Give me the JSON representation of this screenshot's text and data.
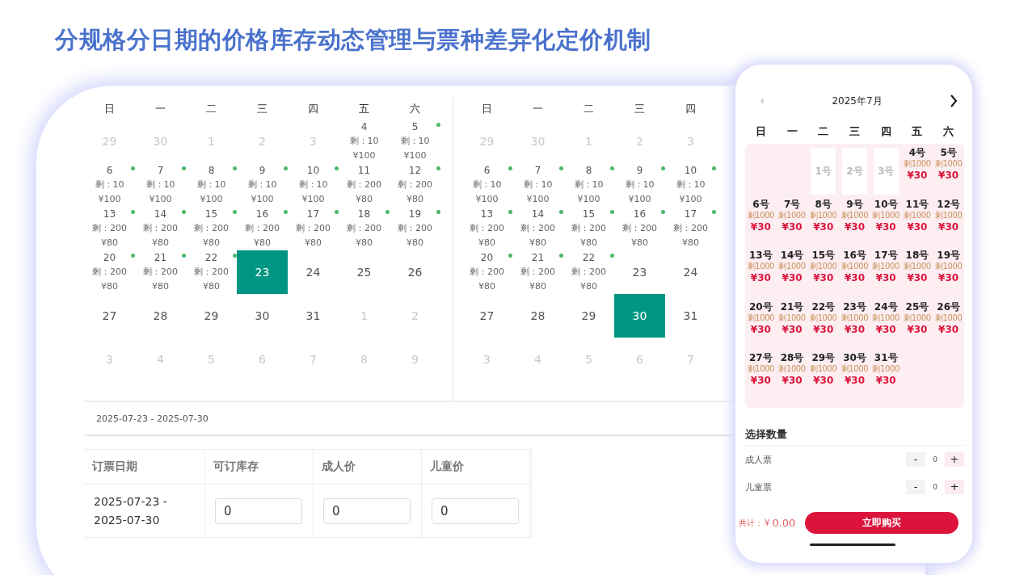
{
  "title": "分规格分日期的价格库存动态管理与票种差异化定价机制",
  "admin": {
    "calendars": [
      {
        "weekdays": [
          "日",
          "一",
          "二",
          "三",
          "四",
          "五",
          "六"
        ],
        "weeks": [
          [
            {
              "day": "29",
              "muted": true,
              "selected": false,
              "dot": false
            },
            {
              "day": "30",
              "muted": true,
              "selected": false,
              "dot": false
            },
            {
              "day": "1",
              "muted": true,
              "selected": false,
              "dot": false
            },
            {
              "day": "2",
              "muted": true,
              "selected": false,
              "dot": false
            },
            {
              "day": "3",
              "muted": true,
              "selected": false,
              "dot": false
            },
            {
              "day": "4",
              "muted": false,
              "selected": false,
              "dot": false,
              "stock": "剩：10",
              "price": "¥100"
            },
            {
              "day": "5",
              "muted": false,
              "selected": false,
              "dot": true,
              "stock": "剩：10",
              "price": "¥100"
            }
          ],
          [
            {
              "day": "6",
              "muted": false,
              "selected": false,
              "dot": true,
              "stock": "剩：10",
              "price": "¥100"
            },
            {
              "day": "7",
              "muted": false,
              "selected": false,
              "dot": true,
              "stock": "剩：10",
              "price": "¥100"
            },
            {
              "day": "8",
              "muted": false,
              "selected": false,
              "dot": true,
              "stock": "剩：10",
              "price": "¥100"
            },
            {
              "day": "9",
              "muted": false,
              "selected": false,
              "dot": true,
              "stock": "剩：10",
              "price": "¥100"
            },
            {
              "day": "10",
              "muted": false,
              "selected": false,
              "dot": true,
              "stock": "剩：10",
              "price": "¥100"
            },
            {
              "day": "11",
              "muted": false,
              "selected": false,
              "dot": false,
              "stock": "剩：200",
              "price": "¥80"
            },
            {
              "day": "12",
              "muted": false,
              "selected": false,
              "dot": true,
              "stock": "剩：200",
              "price": "¥80"
            }
          ],
          [
            {
              "day": "13",
              "muted": false,
              "selected": false,
              "dot": true,
              "stock": "剩：200",
              "price": "¥80"
            },
            {
              "day": "14",
              "muted": false,
              "selected": false,
              "dot": true,
              "stock": "剩：200",
              "price": "¥80"
            },
            {
              "day": "15",
              "muted": false,
              "selected": false,
              "dot": true,
              "stock": "剩：200",
              "price": "¥80"
            },
            {
              "day": "16",
              "muted": false,
              "selected": false,
              "dot": true,
              "stock": "剩：200",
              "price": "¥80"
            },
            {
              "day": "17",
              "muted": false,
              "selected": false,
              "dot": true,
              "stock": "剩：200",
              "price": "¥80"
            },
            {
              "day": "18",
              "muted": false,
              "selected": false,
              "dot": true,
              "stock": "剩：200",
              "price": "¥80"
            },
            {
              "day": "19",
              "muted": false,
              "selected": false,
              "dot": true,
              "stock": "剩：200",
              "price": "¥80"
            }
          ],
          [
            {
              "day": "20",
              "muted": false,
              "selected": false,
              "dot": true,
              "stock": "剩：200",
              "price": "¥80"
            },
            {
              "day": "21",
              "muted": false,
              "selected": false,
              "dot": true,
              "stock": "剩：200",
              "price": "¥80"
            },
            {
              "day": "22",
              "muted": false,
              "selected": false,
              "dot": true,
              "stock": "剩：200",
              "price": "¥80"
            },
            {
              "day": "23",
              "muted": false,
              "selected": true,
              "dot": false
            },
            {
              "day": "24",
              "muted": false,
              "selected": false,
              "dot": false
            },
            {
              "day": "25",
              "muted": false,
              "selected": false,
              "dot": false
            },
            {
              "day": "26",
              "muted": false,
              "selected": false,
              "dot": false
            }
          ],
          [
            {
              "day": "27",
              "muted": false,
              "selected": false,
              "dot": false
            },
            {
              "day": "28",
              "muted": false,
              "selected": false,
              "dot": false
            },
            {
              "day": "29",
              "muted": false,
              "selected": false,
              "dot": false
            },
            {
              "day": "30",
              "muted": false,
              "selected": false,
              "dot": false
            },
            {
              "day": "31",
              "muted": false,
              "selected": false,
              "dot": false
            },
            {
              "day": "1",
              "muted": true,
              "selected": false,
              "dot": false
            },
            {
              "day": "2",
              "muted": true,
              "selected": false,
              "dot": false
            }
          ],
          [
            {
              "day": "3",
              "muted": true,
              "selected": false,
              "dot": false
            },
            {
              "day": "4",
              "muted": true,
              "selected": false,
              "dot": false
            },
            {
              "day": "5",
              "muted": true,
              "selected": false,
              "dot": false
            },
            {
              "day": "6",
              "muted": true,
              "selected": false,
              "dot": false
            },
            {
              "day": "7",
              "muted": true,
              "selected": false,
              "dot": false
            },
            {
              "day": "8",
              "muted": true,
              "selected": false,
              "dot": false
            },
            {
              "day": "9",
              "muted": true,
              "selected": false,
              "dot": false
            }
          ]
        ]
      },
      {
        "weekdays": [
          "日",
          "一",
          "二",
          "三",
          "四"
        ],
        "weeks": [
          [
            {
              "day": "29",
              "muted": true,
              "selected": false,
              "dot": false
            },
            {
              "day": "30",
              "muted": true,
              "selected": false,
              "dot": false
            },
            {
              "day": "1",
              "muted": true,
              "selected": false,
              "dot": false
            },
            {
              "day": "2",
              "muted": true,
              "selected": false,
              "dot": false
            },
            {
              "day": "3",
              "muted": true,
              "selected": false,
              "dot": false
            }
          ],
          [
            {
              "day": "6",
              "muted": false,
              "selected": false,
              "dot": true,
              "stock": "剩：10",
              "price": "¥100"
            },
            {
              "day": "7",
              "muted": false,
              "selected": false,
              "dot": true,
              "stock": "剩：10",
              "price": "¥100"
            },
            {
              "day": "8",
              "muted": false,
              "selected": false,
              "dot": true,
              "stock": "剩：10",
              "price": "¥100"
            },
            {
              "day": "9",
              "muted": false,
              "selected": false,
              "dot": true,
              "stock": "剩：10",
              "price": "¥100"
            },
            {
              "day": "10",
              "muted": false,
              "selected": false,
              "dot": true,
              "stock": "剩：10",
              "price": "¥100"
            }
          ],
          [
            {
              "day": "13",
              "muted": false,
              "selected": false,
              "dot": true,
              "stock": "剩：200",
              "price": "¥80"
            },
            {
              "day": "14",
              "muted": false,
              "selected": false,
              "dot": true,
              "stock": "剩：200",
              "price": "¥80"
            },
            {
              "day": "15",
              "muted": false,
              "selected": false,
              "dot": true,
              "stock": "剩：200",
              "price": "¥80"
            },
            {
              "day": "16",
              "muted": false,
              "selected": false,
              "dot": true,
              "stock": "剩：200",
              "price": "¥80"
            },
            {
              "day": "17",
              "muted": false,
              "selected": false,
              "dot": true,
              "stock": "剩：200",
              "price": "¥80"
            }
          ],
          [
            {
              "day": "20",
              "muted": false,
              "selected": false,
              "dot": true,
              "stock": "剩：200",
              "price": "¥80"
            },
            {
              "day": "21",
              "muted": false,
              "selected": false,
              "dot": true,
              "stock": "剩：200",
              "price": "¥80"
            },
            {
              "day": "22",
              "muted": false,
              "selected": false,
              "dot": true,
              "stock": "剩：200",
              "price": "¥80"
            },
            {
              "day": "23",
              "muted": false,
              "selected": false,
              "dot": false
            },
            {
              "day": "24",
              "muted": false,
              "selected": false,
              "dot": false
            }
          ],
          [
            {
              "day": "27",
              "muted": false,
              "selected": false,
              "dot": false
            },
            {
              "day": "28",
              "muted": false,
              "selected": false,
              "dot": false
            },
            {
              "day": "29",
              "muted": false,
              "selected": false,
              "dot": false
            },
            {
              "day": "30",
              "muted": false,
              "selected": true,
              "dot": false
            },
            {
              "day": "31",
              "muted": false,
              "selected": false,
              "dot": false
            }
          ],
          [
            {
              "day": "3",
              "muted": true,
              "selected": false,
              "dot": false
            },
            {
              "day": "4",
              "muted": true,
              "selected": false,
              "dot": false
            },
            {
              "day": "5",
              "muted": true,
              "selected": false,
              "dot": false
            },
            {
              "day": "6",
              "muted": true,
              "selected": false,
              "dot": false
            },
            {
              "day": "7",
              "muted": true,
              "selected": false,
              "dot": false
            }
          ]
        ]
      }
    ],
    "date_range": "2025-07-23 - 2025-07-30",
    "table": {
      "columns": [
        "订票日期",
        "可订库存",
        "成人价",
        "儿童价"
      ],
      "rows": [
        {
          "date": "2025-07-23 - 2025-07-30",
          "stock": "0",
          "adult_price": "0",
          "child_price": "0"
        }
      ]
    }
  },
  "phone": {
    "month": "2025年7月",
    "prev_disabled": true,
    "weekdays": [
      "日",
      "一",
      "二",
      "三",
      "四",
      "五",
      "六"
    ],
    "days": [
      {
        "kind": "blank"
      },
      {
        "kind": "blank"
      },
      {
        "kind": "day",
        "day": "1号",
        "disabled": true
      },
      {
        "kind": "day",
        "day": "2号",
        "disabled": true
      },
      {
        "kind": "day",
        "day": "3号",
        "disabled": true
      },
      {
        "kind": "day",
        "day": "4号",
        "disabled": false,
        "stock": "剩1000",
        "price": "¥30"
      },
      {
        "kind": "day",
        "day": "5号",
        "disabled": false,
        "stock": "剩1000",
        "price": "¥30"
      },
      {
        "kind": "day",
        "day": "6号",
        "disabled": false,
        "stock": "剩1000",
        "price": "¥30"
      },
      {
        "kind": "day",
        "day": "7号",
        "disabled": false,
        "stock": "剩1000",
        "price": "¥30"
      },
      {
        "kind": "day",
        "day": "8号",
        "disabled": false,
        "stock": "剩1000",
        "price": "¥30"
      },
      {
        "kind": "day",
        "day": "9号",
        "disabled": false,
        "stock": "剩1000",
        "price": "¥30"
      },
      {
        "kind": "day",
        "day": "10号",
        "disabled": false,
        "stock": "剩1000",
        "price": "¥30"
      },
      {
        "kind": "day",
        "day": "11号",
        "disabled": false,
        "stock": "剩1000",
        "price": "¥30"
      },
      {
        "kind": "day",
        "day": "12号",
        "disabled": false,
        "stock": "剩1000",
        "price": "¥30"
      },
      {
        "kind": "day",
        "day": "13号",
        "disabled": false,
        "stock": "剩1000",
        "price": "¥30"
      },
      {
        "kind": "day",
        "day": "14号",
        "disabled": false,
        "stock": "剩1000",
        "price": "¥30"
      },
      {
        "kind": "day",
        "day": "15号",
        "disabled": false,
        "stock": "剩1000",
        "price": "¥30"
      },
      {
        "kind": "day",
        "day": "16号",
        "disabled": false,
        "stock": "剩1000",
        "price": "¥30"
      },
      {
        "kind": "day",
        "day": "17号",
        "disabled": false,
        "stock": "剩1000",
        "price": "¥30"
      },
      {
        "kind": "day",
        "day": "18号",
        "disabled": false,
        "stock": "剩1000",
        "price": "¥30"
      },
      {
        "kind": "day",
        "day": "19号",
        "disabled": false,
        "stock": "剩1000",
        "price": "¥30"
      },
      {
        "kind": "day",
        "day": "20号",
        "disabled": false,
        "stock": "剩1000",
        "price": "¥30"
      },
      {
        "kind": "day",
        "day": "21号",
        "disabled": false,
        "stock": "剩1000",
        "price": "¥30"
      },
      {
        "kind": "day",
        "day": "22号",
        "disabled": false,
        "stock": "剩1000",
        "price": "¥30"
      },
      {
        "kind": "day",
        "day": "23号",
        "disabled": false,
        "stock": "剩1000",
        "price": "¥30"
      },
      {
        "kind": "day",
        "day": "24号",
        "disabled": false,
        "stock": "剩1000",
        "price": "¥30"
      },
      {
        "kind": "day",
        "day": "25号",
        "disabled": false,
        "stock": "剩1000",
        "price": "¥30"
      },
      {
        "kind": "day",
        "day": "26号",
        "disabled": false,
        "stock": "剩1000",
        "price": "¥30"
      },
      {
        "kind": "day",
        "day": "27号",
        "disabled": false,
        "stock": "剩1000",
        "price": "¥30"
      },
      {
        "kind": "day",
        "day": "28号",
        "disabled": false,
        "stock": "剩1000",
        "price": "¥30"
      },
      {
        "kind": "day",
        "day": "29号",
        "disabled": false,
        "stock": "剩1000",
        "price": "¥30"
      },
      {
        "kind": "day",
        "day": "30号",
        "disabled": false,
        "stock": "剩1000",
        "price": "¥30"
      },
      {
        "kind": "day",
        "day": "31号",
        "disabled": false,
        "stock": "剩1000",
        "price": "¥30"
      }
    ],
    "quantity_title": "选择数量",
    "tickets": [
      {
        "label": "成人票",
        "minus": "-",
        "count": "0",
        "plus": "+"
      },
      {
        "label": "儿童票",
        "minus": "-",
        "count": "0",
        "plus": "+"
      }
    ],
    "total_label": "共计：",
    "currency": "¥",
    "total": "0.00",
    "buy_button": "立即购买"
  }
}
